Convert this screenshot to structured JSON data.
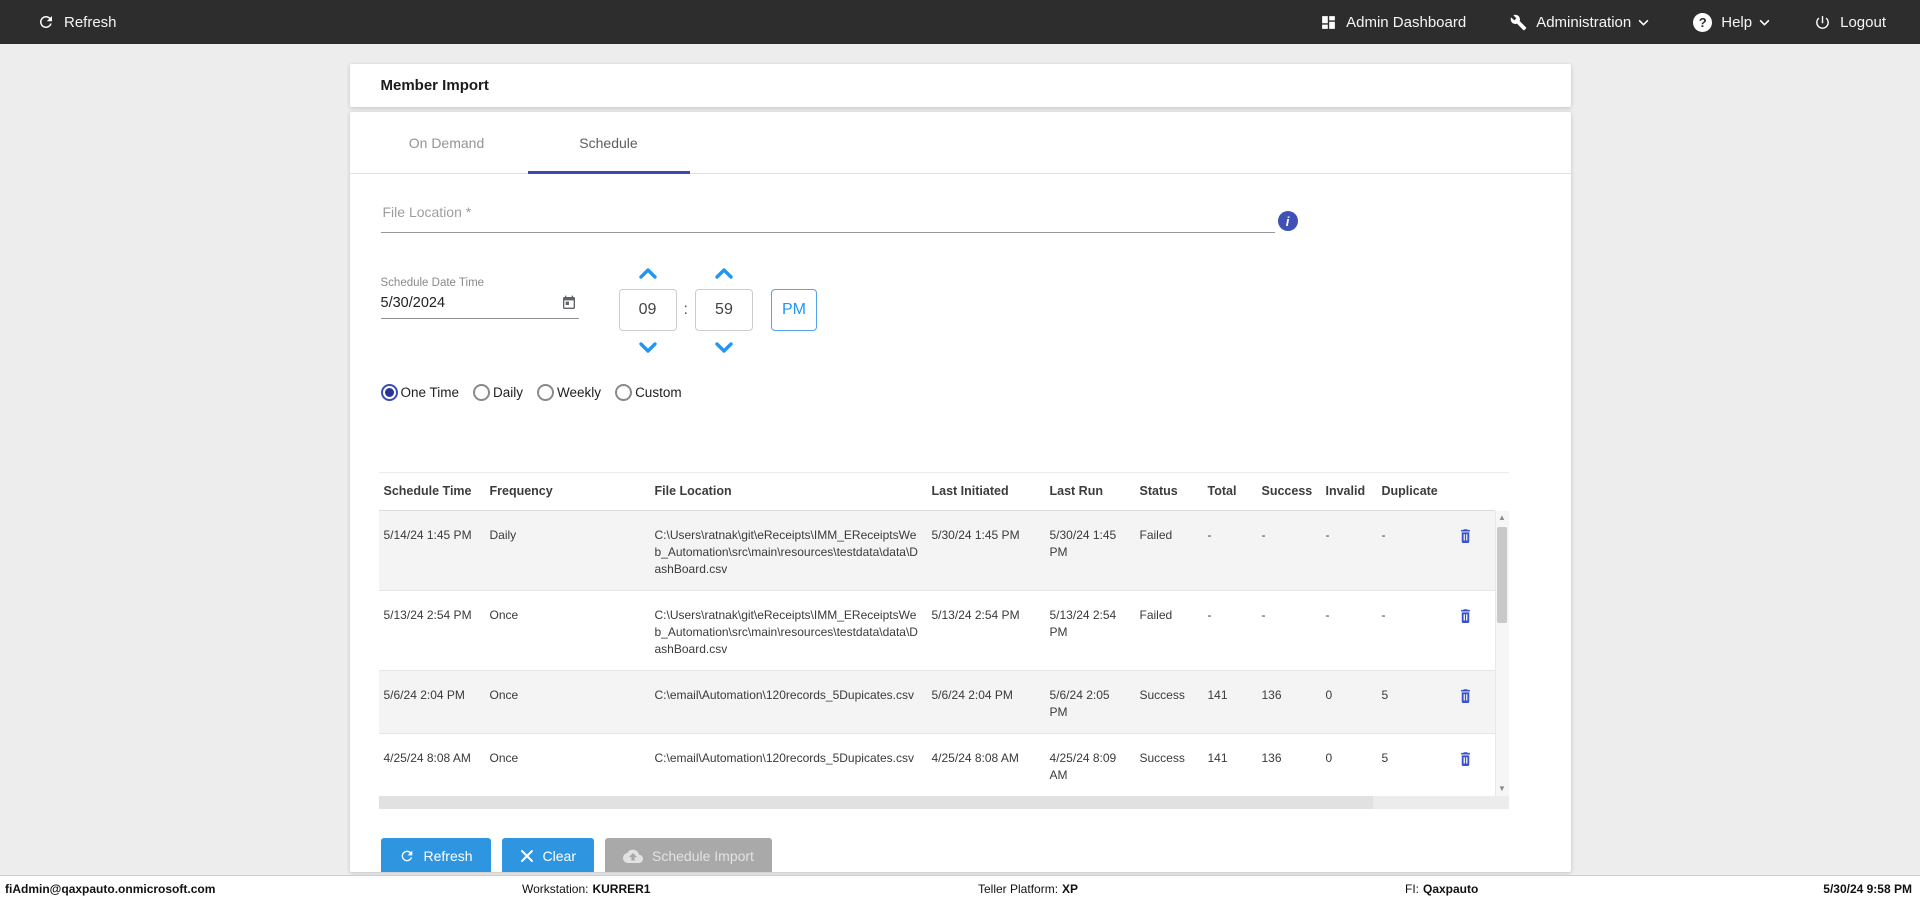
{
  "topbar": {
    "refresh": "Refresh",
    "admin_dashboard": "Admin Dashboard",
    "administration": "Administration",
    "help": "Help",
    "logout": "Logout"
  },
  "page": {
    "title": "Member Import"
  },
  "tabs": {
    "on_demand": "On Demand",
    "schedule": "Schedule"
  },
  "form": {
    "file_location_placeholder": "File Location *",
    "info_icon_glyph": "i",
    "schedule_datetime_label": "Schedule Date Time",
    "date_value": "5/30/2024",
    "hour": "09",
    "minute": "59",
    "time_separator": ":",
    "meridiem": "PM",
    "frequency_options": [
      {
        "label": "One Time",
        "selected": true
      },
      {
        "label": "Daily",
        "selected": false
      },
      {
        "label": "Weekly",
        "selected": false
      },
      {
        "label": "Custom",
        "selected": false
      }
    ]
  },
  "table": {
    "columns": [
      "Schedule Time",
      "Frequency",
      "File Location",
      "Last Initiated",
      "Last Run",
      "Status",
      "Total",
      "Success",
      "Invalid",
      "Duplicate"
    ],
    "rows": [
      {
        "schedule_time": "5/14/24 1:45 PM",
        "frequency": "Daily",
        "file_location": "C:\\Users\\ratnak\\git\\eReceipts\\IMM_EReceiptsWeb_Automation\\src\\main\\resources\\testdata\\data\\DashBoard.csv",
        "last_initiated": "5/30/24 1:45 PM",
        "last_run": "5/30/24 1:45 PM",
        "status": "Failed",
        "total": "-",
        "success": "-",
        "invalid": "-",
        "duplicate": "-"
      },
      {
        "schedule_time": "5/13/24 2:54 PM",
        "frequency": "Once",
        "file_location": "C:\\Users\\ratnak\\git\\eReceipts\\IMM_EReceiptsWeb_Automation\\src\\main\\resources\\testdata\\data\\DashBoard.csv",
        "last_initiated": "5/13/24 2:54 PM",
        "last_run": "5/13/24 2:54 PM",
        "status": "Failed",
        "total": "-",
        "success": "-",
        "invalid": "-",
        "duplicate": "-"
      },
      {
        "schedule_time": "5/6/24 2:04 PM",
        "frequency": "Once",
        "file_location": "C:\\email\\Automation\\120records_5Dupicates.csv",
        "last_initiated": "5/6/24 2:04 PM",
        "last_run": "5/6/24 2:05 PM",
        "status": "Success",
        "total": "141",
        "success": "136",
        "invalid": "0",
        "duplicate": "5"
      },
      {
        "schedule_time": "4/25/24 8:08 AM",
        "frequency": "Once",
        "file_location": "C:\\email\\Automation\\120records_5Dupicates.csv",
        "last_initiated": "4/25/24 8:08 AM",
        "last_run": "4/25/24 8:09 AM",
        "status": "Success",
        "total": "141",
        "success": "136",
        "invalid": "0",
        "duplicate": "5"
      }
    ]
  },
  "buttons": {
    "refresh": "Refresh",
    "clear": "Clear",
    "schedule_import": "Schedule Import"
  },
  "footer": {
    "user": "fiAdmin@qaxpauto.onmicrosoft.com",
    "workstation_label": "Workstation:",
    "workstation": "KURRER1",
    "teller_label": "Teller Platform:",
    "teller": "XP",
    "fi_label": "FI:",
    "fi": "Qaxpauto",
    "datetime": "5/30/24 9:58 PM"
  },
  "colors": {
    "topbar_bg": "#2d2d2d",
    "accent_indigo": "#3f51b5",
    "tab_underline": "#3a4ab0",
    "spinner_blue": "#2196f3",
    "button_blue": "#2e96e0",
    "disabled_gray": "#a9a9a9",
    "page_bg": "#ededed"
  }
}
